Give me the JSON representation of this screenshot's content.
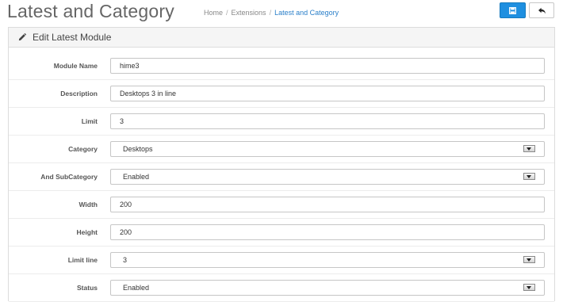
{
  "header": {
    "title": "Latest and Category",
    "breadcrumb": [
      {
        "label": "Home"
      },
      {
        "label": "Extensions"
      },
      {
        "label": "Latest and Category"
      }
    ],
    "separator": "/",
    "save_icon": "save-icon",
    "back_icon": "reply-arrow-icon"
  },
  "panel": {
    "icon": "pencil-icon",
    "title": "Edit Latest Module"
  },
  "form": {
    "module_name": {
      "label": "Module Name",
      "value": "hime3"
    },
    "description": {
      "label": "Description",
      "value": "Desktops 3 in line"
    },
    "limit": {
      "label": "Limit",
      "value": "3"
    },
    "category": {
      "label": "Category",
      "value": "Desktops"
    },
    "subcategory": {
      "label": "And SubCategory",
      "value": "Enabled"
    },
    "width": {
      "label": "Width",
      "value": "200"
    },
    "height": {
      "label": "Height",
      "value": "200"
    },
    "limit_line": {
      "label": "Limit line",
      "value": "3"
    },
    "status": {
      "label": "Status",
      "value": "Enabled"
    }
  },
  "colors": {
    "primary": "#1e8fe0",
    "link": "#2a7fc9"
  }
}
